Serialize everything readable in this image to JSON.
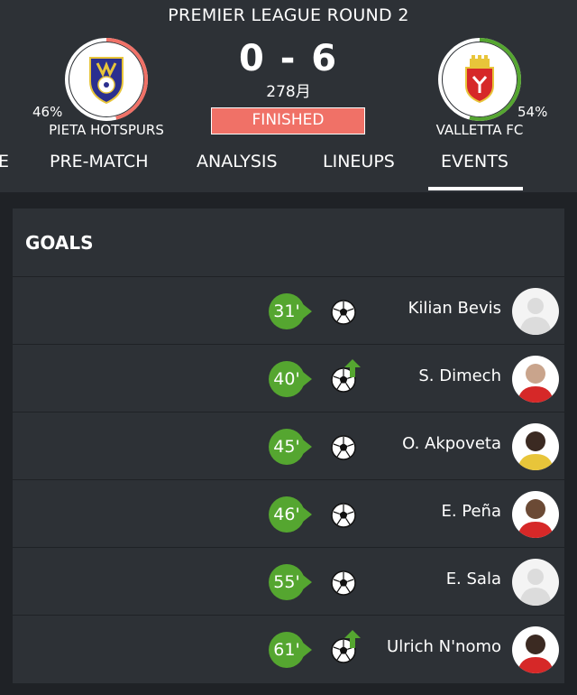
{
  "header": {
    "league_round": "PREMIER LEAGUE ROUND 2",
    "score": "0 - 6",
    "date": "278月",
    "status": "FINISHED",
    "status_color": "#f07167",
    "home": {
      "name": "PIETA HOTSPURS",
      "pct": "46%",
      "possession": 0.46,
      "ring_color": "#f07167"
    },
    "away": {
      "name": "VALLETTA FC",
      "pct": "54%",
      "possession": 0.54,
      "ring_color": "#55a630"
    }
  },
  "tabs": [
    {
      "label": "E",
      "active": false
    },
    {
      "label": "PRE-MATCH",
      "active": false
    },
    {
      "label": "ANALYSIS",
      "active": false
    },
    {
      "label": "LINEUPS",
      "active": false
    },
    {
      "label": "EVENTS",
      "active": true
    }
  ],
  "goals": {
    "heading": "GOALS",
    "badge_color": "#55a630",
    "events": [
      {
        "minute": "31'",
        "player": "Kilian Bevis",
        "type": "goal",
        "avatar": "placeholder"
      },
      {
        "minute": "40'",
        "player": "S. Dimech",
        "type": "goal-assist",
        "avatar": "photo"
      },
      {
        "minute": "45'",
        "player": "O. Akpoveta",
        "type": "goal",
        "avatar": "photo"
      },
      {
        "minute": "46'",
        "player": "E. Peña",
        "type": "goal",
        "avatar": "photo"
      },
      {
        "minute": "55'",
        "player": "E. Sala",
        "type": "goal",
        "avatar": "placeholder"
      },
      {
        "minute": "61'",
        "player": "Ulrich N'nomo",
        "type": "goal-assist",
        "avatar": "photo"
      }
    ]
  }
}
